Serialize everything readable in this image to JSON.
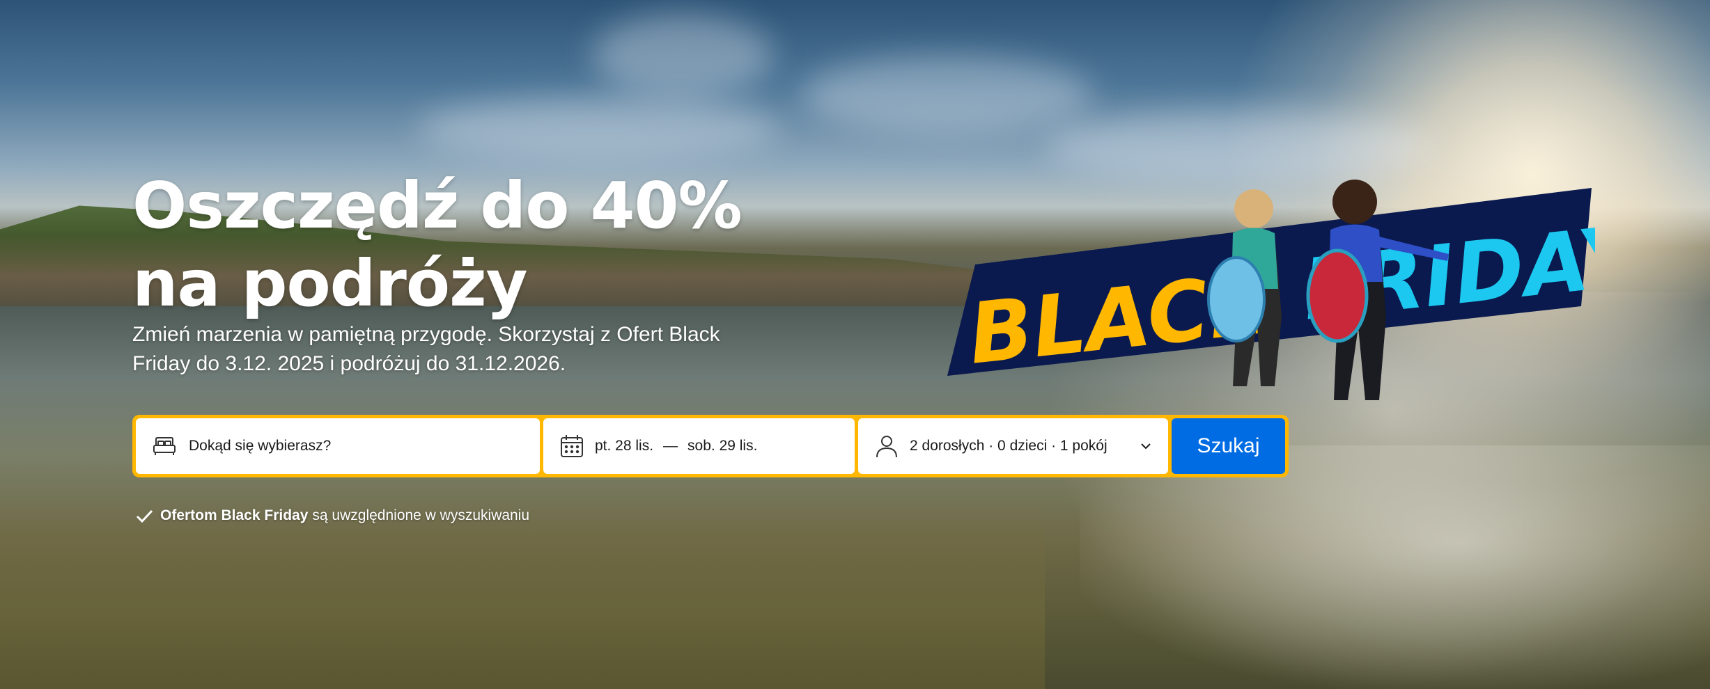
{
  "hero": {
    "headline_line1": "Oszczędź do 40%",
    "headline_line2": "na podróży",
    "subtitle": "Zmień marzenia w pamiętną przygodę. Skorzystaj z Ofert Black Friday do 3.12. 2025 i podróżuj do 31.12.2026.",
    "banner_word1": "BLACK",
    "banner_word2": "FRIDAY"
  },
  "search": {
    "destination_placeholder": "Dokąd się wybierasz?",
    "checkin": "pt. 28 lis.",
    "date_separator": "—",
    "checkout": "sob. 29 lis.",
    "guests": "2 dorosłych · 0 dzieci · 1 pokój",
    "submit_label": "Szukaj"
  },
  "note": {
    "bold": "Ofertom Black Friday",
    "rest": "są uwzględnione w wyszukiwaniu"
  },
  "colors": {
    "search_border": "#ffb700",
    "button": "#006ce4",
    "banner_bg": "#0a1a4f",
    "banner_black": "#ffb700",
    "banner_friday": "#1cc8f0"
  },
  "icons": {
    "destination": "bed-icon",
    "dates": "calendar-icon",
    "guests": "person-icon",
    "dropdown": "chevron-down-icon",
    "note": "checkmark-icon"
  }
}
